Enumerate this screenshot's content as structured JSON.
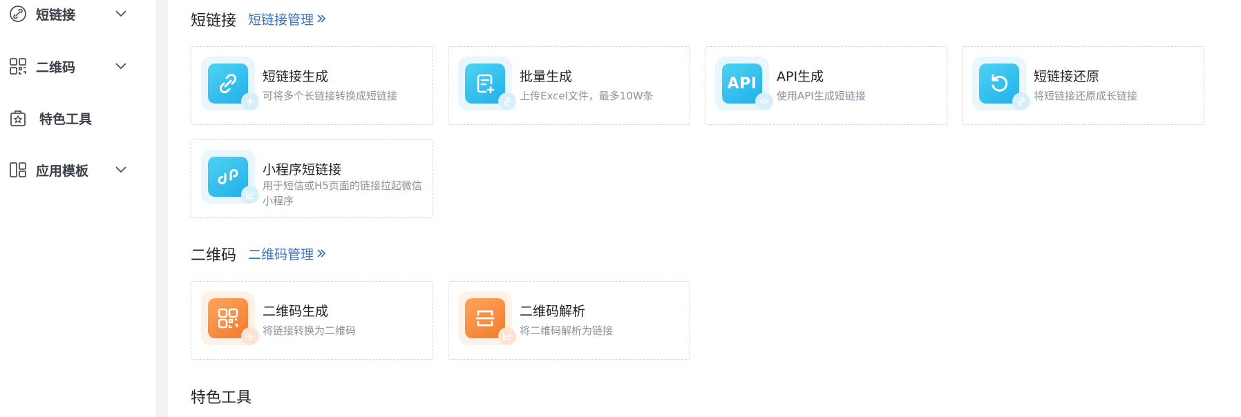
{
  "sidebar": {
    "items": [
      {
        "label": "短链接",
        "icon": "link-circle-icon",
        "has_chevron": true
      },
      {
        "label": "二维码",
        "icon": "qrcode-icon",
        "has_chevron": true
      },
      {
        "label": "特色工具",
        "icon": "star-bag-icon",
        "has_chevron": false
      },
      {
        "label": "应用模板",
        "icon": "template-icon",
        "has_chevron": true
      }
    ]
  },
  "sections": {
    "shortlink": {
      "title": "短链接",
      "manage_link": "短链接管理",
      "cards": [
        {
          "title": "短链接生成",
          "desc": "可将多个长链接转换成短链接",
          "icon": "link-icon",
          "badge": "plus-icon"
        },
        {
          "title": "批量生成",
          "desc": "上传Excel文件，最多10W条",
          "icon": "document-add-icon",
          "badge": "link-badge-icon"
        },
        {
          "title": "API生成",
          "desc": "使用API生成短链接",
          "icon": "api-icon",
          "icon_text": "API",
          "badge": "code-icon"
        },
        {
          "title": "短链接还原",
          "desc": "将短链接还原成长链接",
          "icon": "restore-icon",
          "badge": "link-badge-icon"
        },
        {
          "title": "小程序短链接",
          "desc": "用于短信或H5页面的链接拉起微信小程序",
          "icon": "miniprogram-icon",
          "badge": "chart-icon"
        }
      ]
    },
    "qrcode": {
      "title": "二维码",
      "manage_link": "二维码管理",
      "cards": [
        {
          "title": "二维码生成",
          "desc": "将链接转换为二维码",
          "icon": "qrcode-generate-icon",
          "badge": "plus-icon"
        },
        {
          "title": "二维码解析",
          "desc": "将二维码解析为链接",
          "icon": "scan-icon",
          "badge": "chart-icon"
        }
      ]
    },
    "tools": {
      "title": "特色工具"
    }
  },
  "colors": {
    "accent_link": "#3a73c4",
    "blue_tile": "#1fb0ea",
    "orange_tile": "#f27b2c",
    "sidebar_text": "#3a3f4a",
    "muted_text": "#8a8f99"
  }
}
